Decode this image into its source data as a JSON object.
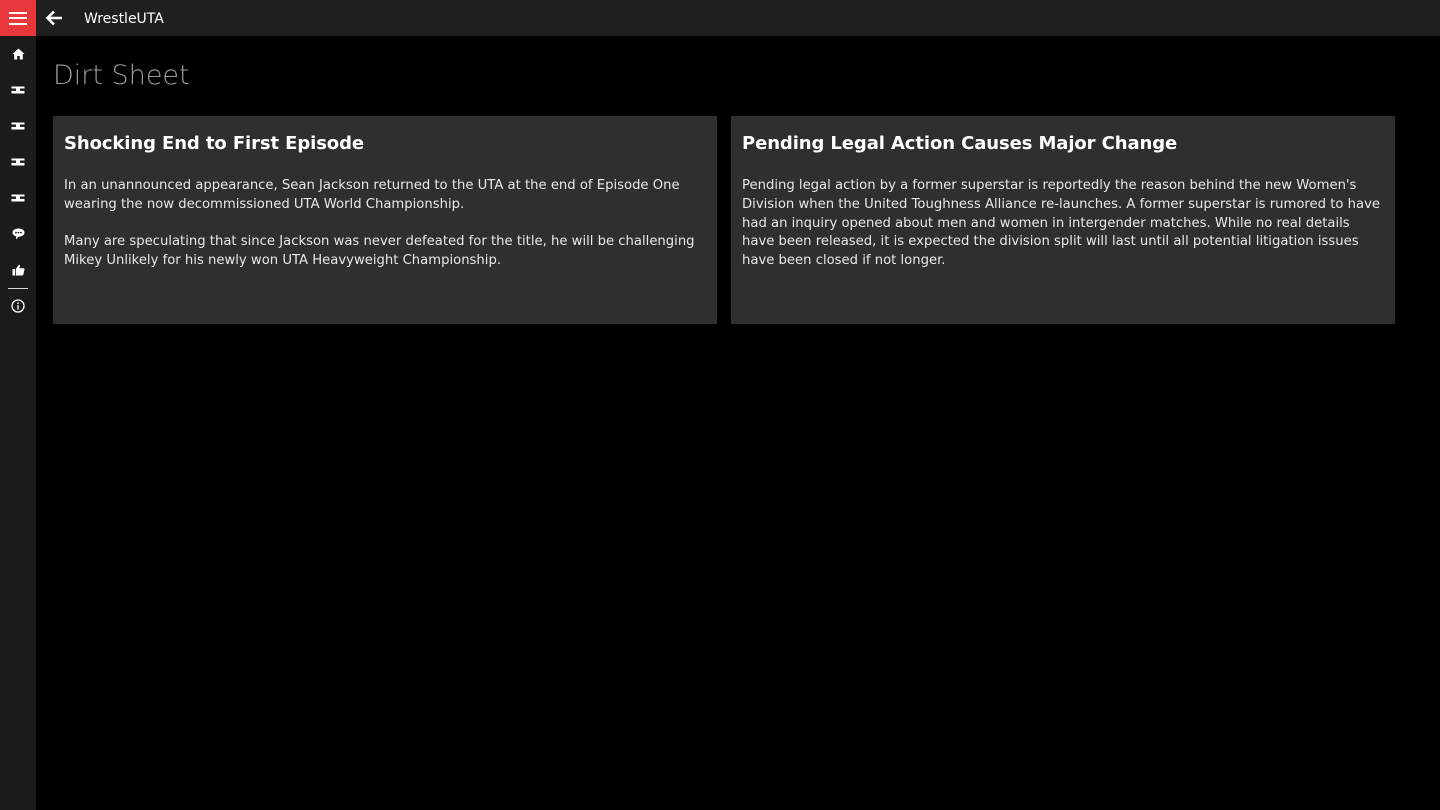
{
  "app": {
    "title": "WrestleUTA",
    "accent_color": "#e8383c"
  },
  "titlebar": {
    "menu_icon": "hamburger-menu-icon",
    "back_icon": "back-arrow-icon"
  },
  "sidebar": {
    "items": [
      {
        "id": "home",
        "icon": "home-icon"
      },
      {
        "id": "belt-1",
        "icon": "belt-icon"
      },
      {
        "id": "belt-2",
        "icon": "belt-icon"
      },
      {
        "id": "belt-3",
        "icon": "belt-icon"
      },
      {
        "id": "belt-4",
        "icon": "belt-icon"
      },
      {
        "id": "dirt-sheet",
        "icon": "chat-bubble-icon"
      },
      {
        "id": "like",
        "icon": "thumbs-up-icon"
      },
      {
        "id": "about",
        "icon": "info-icon"
      }
    ]
  },
  "page": {
    "title": "Dirt Sheet"
  },
  "articles": [
    {
      "title": "Shocking End to First Episode",
      "paragraphs": [
        "In an unannounced appearance, Sean Jackson returned to the UTA at the end of Episode One wearing the now decommissioned UTA World Championship.",
        "Many are speculating that since Jackson was never defeated for the title, he will be challenging Mikey Unlikely for his newly won UTA Heavyweight Championship."
      ]
    },
    {
      "title": "Pending Legal Action Causes Major Change",
      "paragraphs": [
        "Pending legal action by a former superstar is reportedly the reason behind the new Women's Division when the United Toughness Alliance re-launches. A former superstar is rumored to have had an inquiry opened about men and women in intergender matches. While no real details have been released, it is expected the division split will last until all potential litigation issues have been closed if not longer."
      ]
    }
  ]
}
